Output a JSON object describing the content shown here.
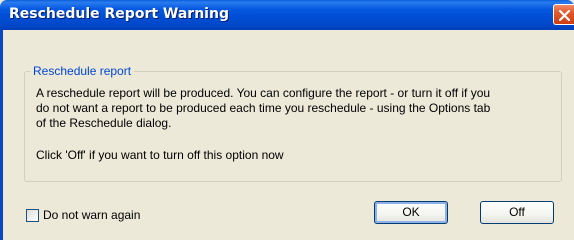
{
  "window": {
    "title": "Reschedule Report Warning"
  },
  "group": {
    "legend": "Reschedule report",
    "lines": [
      "A reschedule report will be produced. You can configure the report - or turn it off if you",
      "do not want a report to be produced each time you reschedule - using the Options tab",
      "of the Reschedule dialog.",
      "Click 'Off' if you want to turn off this option now"
    ]
  },
  "footer": {
    "checkbox_label": "Do not warn again",
    "checkbox_checked": false,
    "ok_label": "OK",
    "off_label": "Off"
  },
  "colors": {
    "titlebar": "#0054e3",
    "close_button": "#e25a2c",
    "legend_text": "#0046d5",
    "window_background": "#ece9d8"
  },
  "icons": {
    "close": "close-icon"
  }
}
